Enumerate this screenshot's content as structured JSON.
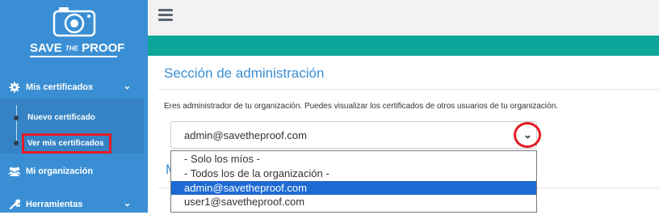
{
  "sidebar": {
    "logo_text_main_1": "SAVE",
    "logo_text_small": "THE",
    "logo_text_main_2": "PROOF",
    "menu_mis_certificados": "Mis certificados",
    "submenu": [
      "Nuevo certificado",
      "Ver mis certificados"
    ],
    "menu_mi_organizacion": "Mi organización",
    "menu_herramientas": "Herramientas"
  },
  "main": {
    "section_title": "Sección de administración",
    "description": "Eres administrador de tu organización. Puedes visualizar los certificados de otros usuarios de tu organización.",
    "select_value": "admin@savetheproof.com",
    "ghost_heading": "M",
    "dropdown_options": [
      "- Solo los míos -",
      "- Todos los de la organización -",
      "admin@savetheproof.com",
      "user1@savetheproof.com"
    ],
    "selected_option_index": 2
  },
  "colors": {
    "sidebar": "#3a8fd4",
    "teal_bar": "#0ea59a",
    "highlight_red": "#e51b24",
    "selected_option": "#1e6ad2"
  },
  "icons": [
    "camera-logo-icon",
    "gear-icon",
    "chevron-down-icon",
    "users-icon",
    "wrench-icon",
    "hamburger-icon"
  ]
}
